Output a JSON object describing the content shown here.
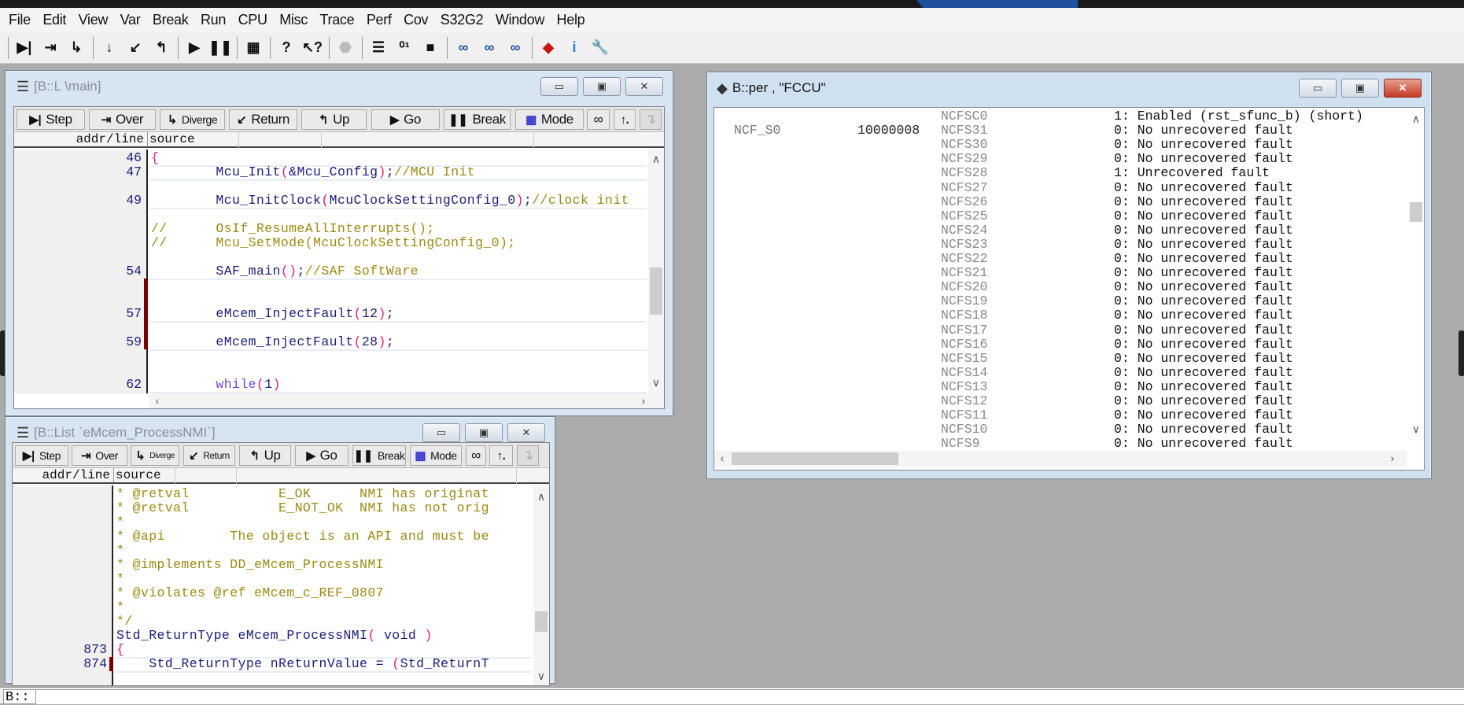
{
  "menu": [
    "File",
    "Edit",
    "View",
    "Var",
    "Break",
    "Run",
    "CPU",
    "Misc",
    "Trace",
    "Perf",
    "Cov",
    "S32G2",
    "Window",
    "Help"
  ],
  "toolbar": {
    "groups": [
      [
        {
          "icon": "step-icon",
          "glyph": "▶|"
        },
        {
          "icon": "step-over-icon",
          "glyph": "⇥"
        },
        {
          "icon": "diverge-icon",
          "glyph": "↳"
        }
      ],
      [
        {
          "icon": "step-down-icon",
          "glyph": "↓"
        },
        {
          "icon": "return-icon",
          "glyph": "↙"
        },
        {
          "icon": "up-icon",
          "glyph": "↰"
        }
      ],
      [
        {
          "icon": "go-icon",
          "glyph": "▶"
        },
        {
          "icon": "break-icon",
          "glyph": "❚❚"
        }
      ],
      [
        {
          "icon": "mode-icon",
          "glyph": "▦"
        }
      ],
      [
        {
          "icon": "help-icon",
          "glyph": "?"
        },
        {
          "icon": "context-help-icon",
          "glyph": "↖?"
        }
      ],
      [
        {
          "icon": "stop-icon",
          "glyph": "⬣"
        }
      ],
      [
        {
          "icon": "list-icon",
          "glyph": "☰"
        },
        {
          "icon": "memory-dump-icon",
          "glyph": "⁰¹"
        },
        {
          "icon": "chip-icon",
          "glyph": "■"
        }
      ],
      [
        {
          "icon": "watch-add-icon",
          "glyph": "∞"
        },
        {
          "icon": "watch-icon",
          "glyph": "∞"
        },
        {
          "icon": "watch-list-icon",
          "glyph": "∞"
        }
      ],
      [
        {
          "icon": "cube-icon",
          "glyph": "◆"
        },
        {
          "icon": "info-icon",
          "glyph": "i"
        },
        {
          "icon": "wrench-icon",
          "glyph": "🔧"
        }
      ]
    ]
  },
  "list_window": {
    "title": "[B::L \\main]",
    "buttons": {
      "step": "Step",
      "over": "Over",
      "diverge": "Diverge",
      "return": "Return",
      "up": "Up",
      "go": "Go",
      "break": "Break",
      "mode": "Mode"
    },
    "col_addr": "addr/line",
    "col_source": "source",
    "rows": [
      {
        "line": "46",
        "bp": false,
        "parts": [
          [
            "pn",
            "{"
          ]
        ]
      },
      {
        "line": "47",
        "bp": false,
        "parts": [
          [
            "fn",
            "        Mcu_Init"
          ],
          [
            "pn",
            "("
          ],
          [
            "fn",
            "&Mcu_Config"
          ],
          [
            "pn",
            ")"
          ],
          [
            "fn",
            ";"
          ],
          [
            "cm",
            "//MCU Init"
          ]
        ]
      },
      {
        "line": "",
        "bp": false,
        "parts": []
      },
      {
        "line": "49",
        "bp": false,
        "parts": [
          [
            "fn",
            "        Mcu_InitClock"
          ],
          [
            "pn",
            "("
          ],
          [
            "fn",
            "McuClockSettingConfig_0"
          ],
          [
            "pn",
            ")"
          ],
          [
            "fn",
            ";"
          ],
          [
            "cm",
            "//clock init"
          ]
        ]
      },
      {
        "line": "",
        "bp": false,
        "parts": []
      },
      {
        "line": "",
        "bp": false,
        "parts": [
          [
            "cm",
            "//      OsIf_ResumeAllInterrupts();"
          ]
        ]
      },
      {
        "line": "",
        "bp": false,
        "parts": [
          [
            "cm",
            "//      Mcu_SetMode(McuClockSettingConfig_0);"
          ]
        ]
      },
      {
        "line": "",
        "bp": false,
        "parts": []
      },
      {
        "line": "54",
        "bp": false,
        "parts": [
          [
            "fn",
            "        SAF_main"
          ],
          [
            "pn",
            "()"
          ],
          [
            "fn",
            ";"
          ],
          [
            "cm",
            "//SAF SoftWare"
          ]
        ]
      },
      {
        "line": "",
        "bp": true,
        "parts": []
      },
      {
        "line": "",
        "bp": true,
        "parts": []
      },
      {
        "line": "57",
        "bp": true,
        "parts": [
          [
            "fn",
            "        eMcem_InjectFault"
          ],
          [
            "pn",
            "("
          ],
          [
            "fn",
            "12"
          ],
          [
            "pn",
            ")"
          ],
          [
            "fn",
            ";"
          ]
        ]
      },
      {
        "line": "",
        "bp": true,
        "parts": []
      },
      {
        "line": "59",
        "bp": true,
        "parts": [
          [
            "fn",
            "        eMcem_InjectFault"
          ],
          [
            "pn",
            "("
          ],
          [
            "fn",
            "28"
          ],
          [
            "pn",
            ")"
          ],
          [
            "fn",
            ";"
          ]
        ]
      },
      {
        "line": "",
        "bp": false,
        "parts": []
      },
      {
        "line": "",
        "bp": false,
        "parts": []
      },
      {
        "line": "62",
        "bp": false,
        "parts": [
          [
            "kw",
            "        while"
          ],
          [
            "pn",
            "("
          ],
          [
            "fn",
            "1"
          ],
          [
            "pn",
            ")"
          ]
        ]
      }
    ]
  },
  "nmi_window": {
    "title": "[B::List `eMcem_ProcessNMI`]",
    "buttons": {
      "step": "Step",
      "over": "Over",
      "diverge": "Diverge",
      "return": "Return",
      "up": "Up",
      "go": "Go",
      "break": "Break",
      "mode": "Mode"
    },
    "col_addr": "addr/line",
    "col_source": "source",
    "rows": [
      {
        "line": "",
        "bp": false,
        "parts": [
          [
            "cm",
            "* @retval           E_OK      NMI has originat"
          ]
        ]
      },
      {
        "line": "",
        "bp": false,
        "parts": [
          [
            "cm",
            "* @retval           E_NOT_OK  NMI has not orig"
          ]
        ]
      },
      {
        "line": "",
        "bp": false,
        "parts": [
          [
            "cm",
            "*"
          ]
        ]
      },
      {
        "line": "",
        "bp": false,
        "parts": [
          [
            "cm",
            "* @api        The object is an API and must be"
          ]
        ]
      },
      {
        "line": "",
        "bp": false,
        "parts": [
          [
            "cm",
            "*"
          ]
        ]
      },
      {
        "line": "",
        "bp": false,
        "parts": [
          [
            "cm",
            "* @implements DD_eMcem_ProcessNMI"
          ]
        ]
      },
      {
        "line": "",
        "bp": false,
        "parts": [
          [
            "cm",
            "*"
          ]
        ]
      },
      {
        "line": "",
        "bp": false,
        "parts": [
          [
            "cm",
            "* @violates @ref eMcem_c_REF_0807"
          ]
        ]
      },
      {
        "line": "",
        "bp": false,
        "parts": [
          [
            "cm",
            "*"
          ]
        ]
      },
      {
        "line": "",
        "bp": false,
        "parts": [
          [
            "cm",
            "*/"
          ]
        ]
      },
      {
        "line": "",
        "bp": false,
        "parts": [
          [
            "fn",
            "Std_ReturnType eMcem_ProcessNMI"
          ],
          [
            "pn",
            "("
          ],
          [
            "fn",
            " void "
          ],
          [
            "pn",
            ")"
          ]
        ]
      },
      {
        "line": "873",
        "bp": false,
        "parts": [
          [
            "pn",
            "{"
          ]
        ]
      },
      {
        "line": "874",
        "bp": true,
        "parts": [
          [
            "fn",
            "    Std_ReturnType nReturnValue = "
          ],
          [
            "pn",
            "("
          ],
          [
            "fn",
            "Std_ReturnT"
          ]
        ]
      }
    ]
  },
  "per_window": {
    "title": "B::per , \"FCCU\"",
    "register": "NCF_S0",
    "register_value": "10000008",
    "fields": [
      {
        "name": "NCFSC0",
        "value": "1: Enabled (rst_sfunc_b) (short)"
      },
      {
        "name": "NCFS31",
        "value": "0: No unrecovered fault"
      },
      {
        "name": "NCFS30",
        "value": "0: No unrecovered fault"
      },
      {
        "name": "NCFS29",
        "value": "0: No unrecovered fault"
      },
      {
        "name": "NCFS28",
        "value": "1: Unrecovered fault"
      },
      {
        "name": "NCFS27",
        "value": "0: No unrecovered fault"
      },
      {
        "name": "NCFS26",
        "value": "0: No unrecovered fault"
      },
      {
        "name": "NCFS25",
        "value": "0: No unrecovered fault"
      },
      {
        "name": "NCFS24",
        "value": "0: No unrecovered fault"
      },
      {
        "name": "NCFS23",
        "value": "0: No unrecovered fault"
      },
      {
        "name": "NCFS22",
        "value": "0: No unrecovered fault"
      },
      {
        "name": "NCFS21",
        "value": "0: No unrecovered fault"
      },
      {
        "name": "NCFS20",
        "value": "0: No unrecovered fault"
      },
      {
        "name": "NCFS19",
        "value": "0: No unrecovered fault"
      },
      {
        "name": "NCFS18",
        "value": "0: No unrecovered fault"
      },
      {
        "name": "NCFS17",
        "value": "0: No unrecovered fault"
      },
      {
        "name": "NCFS16",
        "value": "0: No unrecovered fault"
      },
      {
        "name": "NCFS15",
        "value": "0: No unrecovered fault"
      },
      {
        "name": "NCFS14",
        "value": "0: No unrecovered fault"
      },
      {
        "name": "NCFS13",
        "value": "0: No unrecovered fault"
      },
      {
        "name": "NCFS12",
        "value": "0: No unrecovered fault"
      },
      {
        "name": "NCFS11",
        "value": "0: No unrecovered fault"
      },
      {
        "name": "NCFS10",
        "value": "0: No unrecovered fault"
      },
      {
        "name": "NCFS9",
        "value": "0: No unrecovered fault"
      }
    ]
  },
  "command_line": {
    "prompt": "B::",
    "value": ""
  },
  "colors": {
    "workspace": "#ababab",
    "code_function": "#1c1c78",
    "code_comment": "#9a8a14",
    "code_paren": "#e0207a",
    "keyword": "#6a4ae8",
    "breakpoint": "#7a0000",
    "close_button": "#c43c24"
  }
}
